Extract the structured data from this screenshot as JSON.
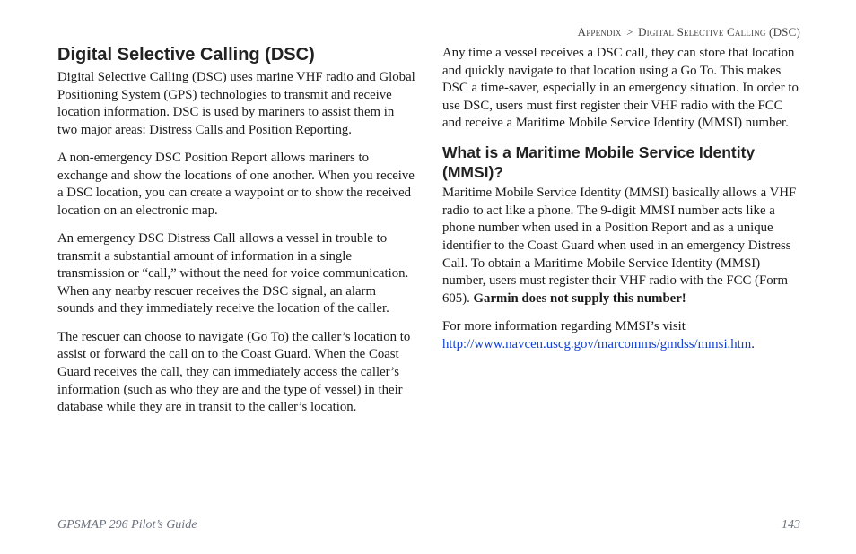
{
  "header": {
    "left": "Appendix",
    "sep": ">",
    "right": "Digital Selective Calling (DSC)"
  },
  "left_column": {
    "h1": "Digital Selective Calling (DSC)",
    "p1": "Digital Selective Calling (DSC) uses marine VHF radio and Global Positioning System (GPS) technologies to transmit and receive location information. DSC is used by mariners to assist them in two major areas: Distress Calls and Position Reporting.",
    "p2": "A non-emergency DSC Position Report allows mariners to exchange and show the locations of one another. When you receive a DSC location, you can create a waypoint or to show the received location on an electronic map.",
    "p3": "An emergency DSC Distress Call allows a vessel in trouble to transmit a substantial amount of information in a single transmission or “call,” without the need for voice communication. When any nearby rescuer receives the DSC signal, an alarm sounds and they immediately receive the location of the caller.",
    "p4": "The rescuer can choose to navigate (Go To) the caller’s location to assist or forward the call on to the Coast Guard. When the Coast Guard receives the call, they can immediately access the caller’s information (such as who they are and the type of vessel) in their database while they are in transit to the caller’s location."
  },
  "right_column": {
    "p1": "Any time a vessel receives a DSC call, they can store that location and quickly navigate to that location using a Go To. This makes DSC a time-saver, especially in an emergency situation. In order to use DSC, users must first register their VHF radio with the FCC and receive a Maritime Mobile Service Identity (MMSI) number.",
    "h2": "What is a Maritime Mobile Service Identity (MMSI)?",
    "p2_main": "Maritime Mobile Service Identity (MMSI) basically allows a VHF radio to act like a phone. The 9-digit MMSI number acts like a phone number when used in a Position Report and as a unique identifier to the Coast Guard when used in an emergency Distress Call. To obtain a Maritime Mobile Service Identity (MMSI) number, users must register their VHF radio with the FCC (Form 605). ",
    "p2_bold": "Garmin does not supply this number!",
    "p3_lead": "For more information regarding MMSI’s visit ",
    "p3_link_text": "http://www.navcen.uscg.gov/marcomms/gmdss/mmsi.htm",
    "p3_tail": "."
  },
  "footer": {
    "guide": "GPSMAP 296 Pilot’s Guide",
    "page": "143"
  },
  "link_href": "http://www.navcen.uscg.gov/marcomms/gmdss/mmsi.htm"
}
